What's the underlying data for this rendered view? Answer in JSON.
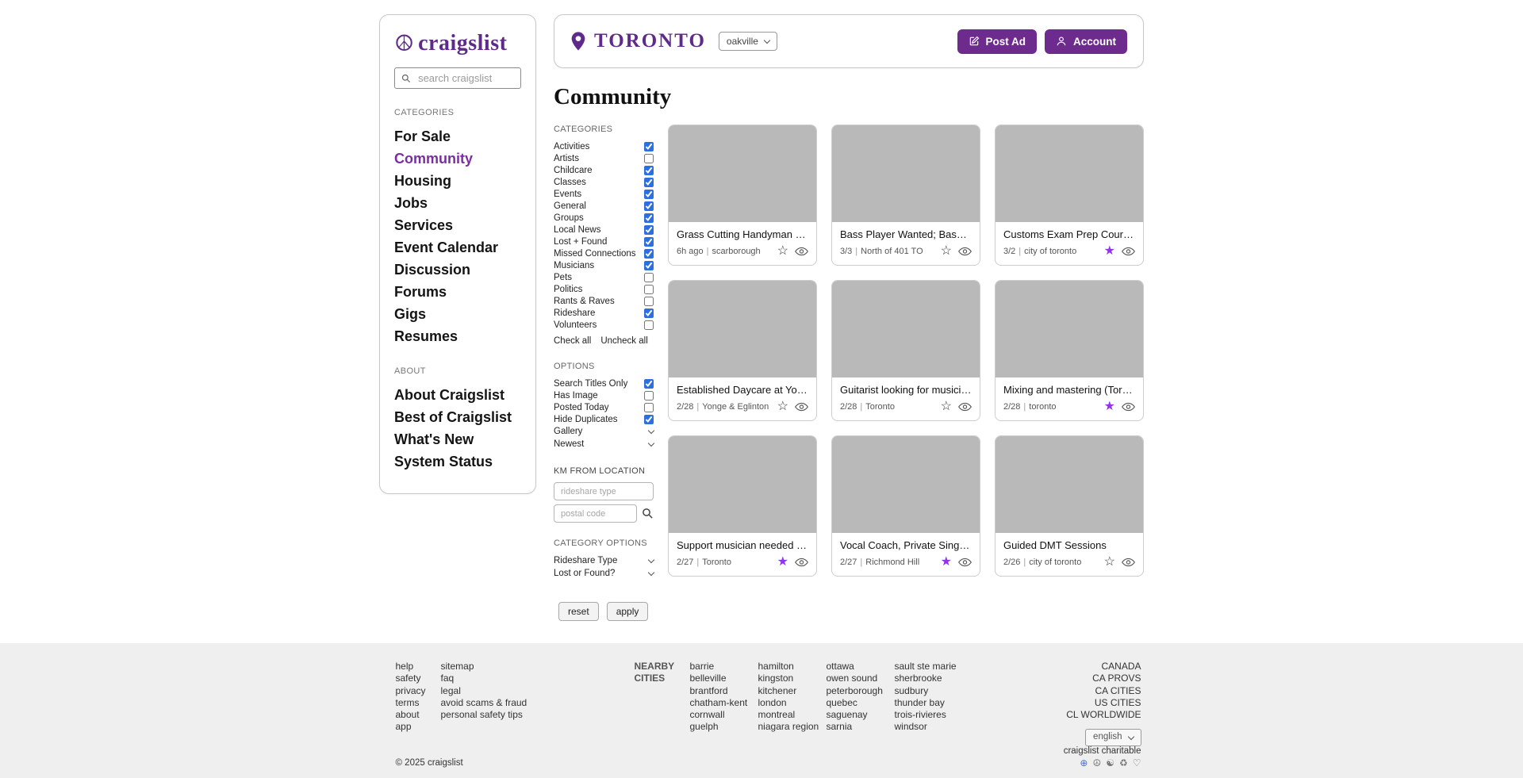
{
  "colors": {
    "accent": "#5f2a8a",
    "button": "#6e2b8e",
    "star_filled": "#9333ea",
    "checkbox": "#2e6fe0",
    "thumb_placeholder": "#b9b9b9",
    "footer_bg": "#efefef"
  },
  "ui": {
    "divider": "|"
  },
  "sidebar": {
    "logo": "craigslist",
    "search_placeholder": "search craigslist",
    "categories_heading": "CATEGORIES",
    "nav": [
      {
        "label": "For Sale",
        "active": false
      },
      {
        "label": "Community",
        "active": true
      },
      {
        "label": "Housing",
        "active": false
      },
      {
        "label": "Jobs",
        "active": false
      },
      {
        "label": "Services",
        "active": false
      },
      {
        "label": "Event Calendar",
        "active": false
      },
      {
        "label": "Discussion Forums",
        "active": false
      },
      {
        "label": "Gigs",
        "active": false
      },
      {
        "label": "Resumes",
        "active": false
      }
    ],
    "about_heading": "ABOUT",
    "about_nav": [
      {
        "label": "About Craigslist"
      },
      {
        "label": "Best of Craigslist"
      },
      {
        "label": "What's New"
      },
      {
        "label": "System Status"
      }
    ]
  },
  "header": {
    "city": "TORONTO",
    "area": "oakville",
    "post_ad": "Post Ad",
    "account": "Account"
  },
  "page_title": "Community",
  "filters": {
    "categories_heading": "CATEGORIES",
    "categories": [
      {
        "label": "Activities",
        "checked": true
      },
      {
        "label": "Artists",
        "checked": false
      },
      {
        "label": "Childcare",
        "checked": true
      },
      {
        "label": "Classes",
        "checked": true
      },
      {
        "label": "Events",
        "checked": true
      },
      {
        "label": "General",
        "checked": true
      },
      {
        "label": "Groups",
        "checked": true
      },
      {
        "label": "Local News",
        "checked": true
      },
      {
        "label": "Lost + Found",
        "checked": true
      },
      {
        "label": "Missed Connections",
        "checked": true
      },
      {
        "label": "Musicians",
        "checked": true
      },
      {
        "label": "Pets",
        "checked": false
      },
      {
        "label": "Politics",
        "checked": false
      },
      {
        "label": "Rants & Raves",
        "checked": false
      },
      {
        "label": "Rideshare",
        "checked": true
      },
      {
        "label": "Volunteers",
        "checked": false
      }
    ],
    "check_all": "Check all",
    "uncheck_all": "Uncheck all",
    "options_heading": "OPTIONS",
    "options": [
      {
        "label": "Search Titles Only",
        "checked": true
      },
      {
        "label": "Has Image",
        "checked": false
      },
      {
        "label": "Posted Today",
        "checked": false
      },
      {
        "label": "Hide Duplicates",
        "checked": true
      }
    ],
    "gallery_dropdown": "Gallery",
    "sort_dropdown": "Newest",
    "km_heading": "KM FROM LOCATION",
    "rideshare_placeholder": "rideshare type",
    "postal_placeholder": "postal code",
    "category_options_heading": "CATEGORY OPTIONS",
    "category_options": [
      {
        "label": "Rideshare Type"
      },
      {
        "label": "Lost or Found?"
      }
    ],
    "reset": "reset",
    "apply": "apply"
  },
  "listings": [
    {
      "title": "Grass Cutting Handyman Re...",
      "date": "6h ago",
      "location": "scarborough",
      "starred": false
    },
    {
      "title": "Bass Player Wanted; Bassist...",
      "date": "3/3",
      "location": "North of 401 TO",
      "starred": false
    },
    {
      "title": "Customs Exam Prep Course t...",
      "date": "3/2",
      "location": "city of toronto",
      "starred": true
    },
    {
      "title": "Established Daycare at Yong...",
      "date": "2/28",
      "location": "Yonge & Eglinton",
      "starred": false
    },
    {
      "title": "Guitarist looking for musician...",
      "date": "2/28",
      "location": "Toronto",
      "starred": false
    },
    {
      "title": "Mixing and mastering (Toronto)",
      "date": "2/28",
      "location": "toronto",
      "starred": true
    },
    {
      "title": "Support musician needed for...",
      "date": "2/27",
      "location": "Toronto",
      "starred": true
    },
    {
      "title": "Vocal Coach, Private Singing...",
      "date": "2/27",
      "location": "Richmond Hill",
      "starred": true
    },
    {
      "title": "Guided DMT Sessions",
      "date": "2/26",
      "location": "city of toronto",
      "starred": false
    }
  ],
  "footer": {
    "links_col1": [
      "help",
      "safety",
      "privacy",
      "terms",
      "about",
      "app"
    ],
    "links_col2": [
      "sitemap",
      "faq",
      "legal",
      "avoid scams & fraud",
      "personal safety tips"
    ],
    "nearby_heading": "NEARBY CITIES",
    "cities": [
      [
        "barrie",
        "belleville",
        "brantford",
        "chatham-kent",
        "cornwall",
        "guelph"
      ],
      [
        "hamilton",
        "kingston",
        "kitchener",
        "london",
        "montreal",
        "niagara region"
      ],
      [
        "ottawa",
        "owen sound",
        "peterborough",
        "quebec",
        "saguenay",
        "sarnia"
      ],
      [
        "sault ste marie",
        "sherbrooke",
        "sudbury",
        "thunder bay",
        "trois-rivieres",
        "windsor"
      ]
    ],
    "region_links": [
      "CANADA",
      "CA PROVS",
      "CA CITIES",
      "US CITIES",
      "CL WORLDWIDE"
    ],
    "language": "english",
    "copyright": "© 2025 craigslist",
    "charitable": "craigslist charitable"
  }
}
